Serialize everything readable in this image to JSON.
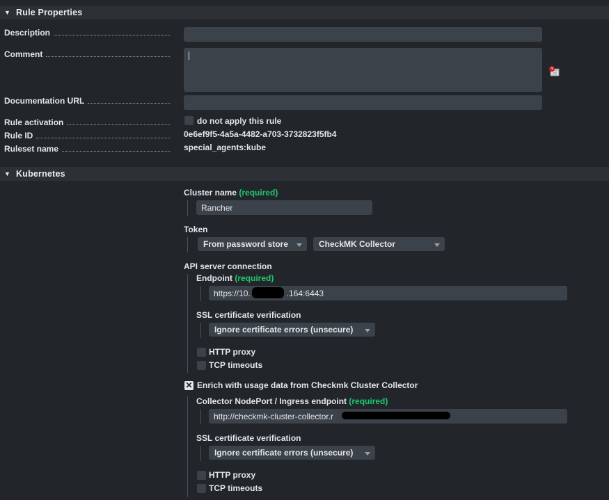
{
  "rule_properties": {
    "header": "Rule Properties",
    "description_label": "Description",
    "description_value": "",
    "comment_label": "Comment",
    "comment_value": "",
    "doc_url_label": "Documentation URL",
    "doc_url_value": "",
    "activation_label": "Rule activation",
    "activation_checkbox_label": "do not apply this rule",
    "rule_id_label": "Rule ID",
    "rule_id_value": "0e6ef9f5-4a5a-4482-a703-3732823f5fb4",
    "ruleset_label": "Ruleset name",
    "ruleset_value": "special_agents:kube"
  },
  "kubernetes": {
    "header": "Kubernetes",
    "required_text": "(required)",
    "cluster_name_label": "Cluster name",
    "cluster_name_value": "Rancher",
    "token_label": "Token",
    "token_source": "From password store",
    "token_entry": "CheckMK Collector",
    "api_label": "API server connection",
    "endpoint_label": "Endpoint",
    "endpoint_value_start": "https://10.",
    "endpoint_value_end": ".164:6443",
    "ssl_label": "SSL certificate verification",
    "ssl_value": "Ignore certificate errors (unsecure)",
    "http_proxy_label": "HTTP proxy",
    "tcp_timeouts_label": "TCP timeouts",
    "enrich_label": "Enrich with usage data from Checkmk Cluster Collector",
    "enrich_checked_glyph": "✕",
    "collector_label": "Collector NodePort / Ingress endpoint",
    "collector_value": "http://checkmk-cluster-collector.r",
    "ssl2_label": "SSL certificate verification",
    "ssl2_value": "Ignore certificate errors (unsecure)",
    "http_proxy2_label": "HTTP proxy",
    "tcp_timeouts2_label": "TCP timeouts"
  },
  "icons": {
    "calendar": "calendar-clock-icon",
    "collapse": "triangle-down-icon"
  }
}
